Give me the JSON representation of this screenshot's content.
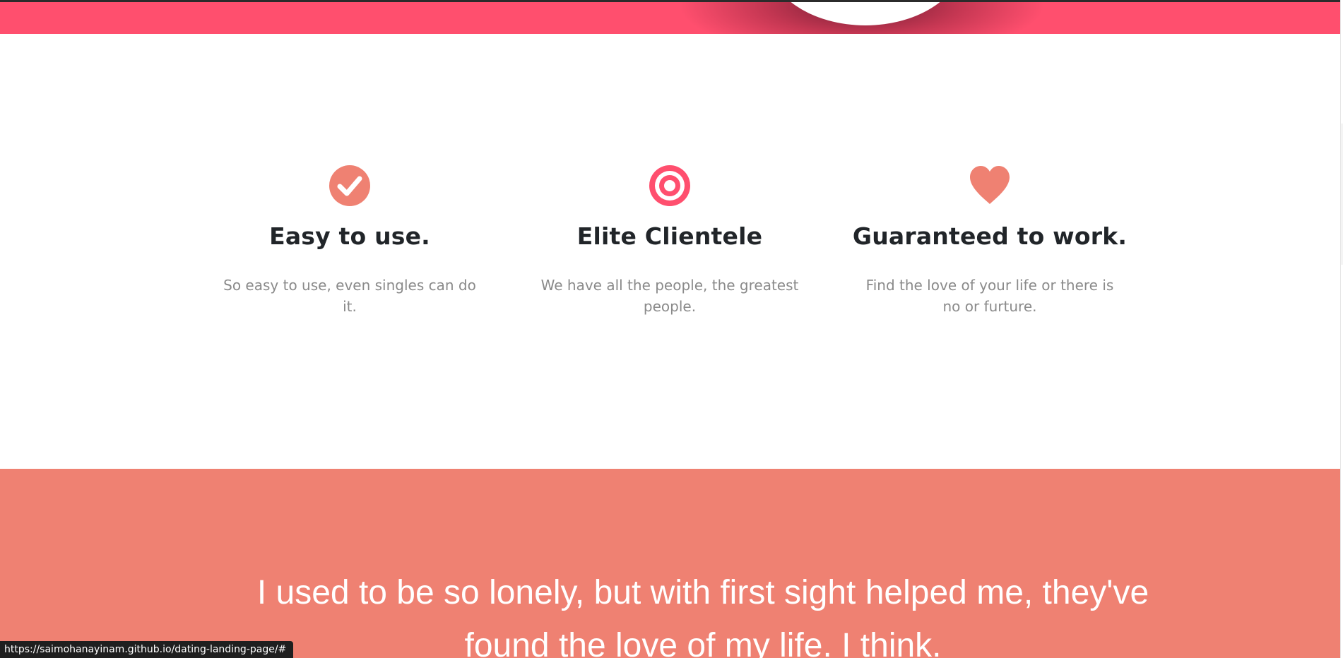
{
  "colors": {
    "hero_pink": "#ff4f6e",
    "testimonial_coral": "#ef8172",
    "heading_dark": "#212529",
    "body_gray": "#8a8a8a",
    "icon_coral": "#ef8172",
    "icon_pink": "#ff4f6e"
  },
  "features": [
    {
      "icon": "check-circle-icon",
      "title": "Easy to use.",
      "description": "So easy to use, even singles can do it."
    },
    {
      "icon": "target-icon",
      "title": "Elite Clientele",
      "description": "We have all the people, the greatest people."
    },
    {
      "icon": "heart-icon",
      "title": "Guaranteed to work.",
      "description": "Find the love of your life or there is no or furture."
    }
  ],
  "testimonial": {
    "quote": "I used to be so lonely, but with first sight helped me, they've found the love of my life. I think."
  },
  "status_bar": {
    "url": "https://saimohanayinam.github.io/dating-landing-page/#"
  }
}
